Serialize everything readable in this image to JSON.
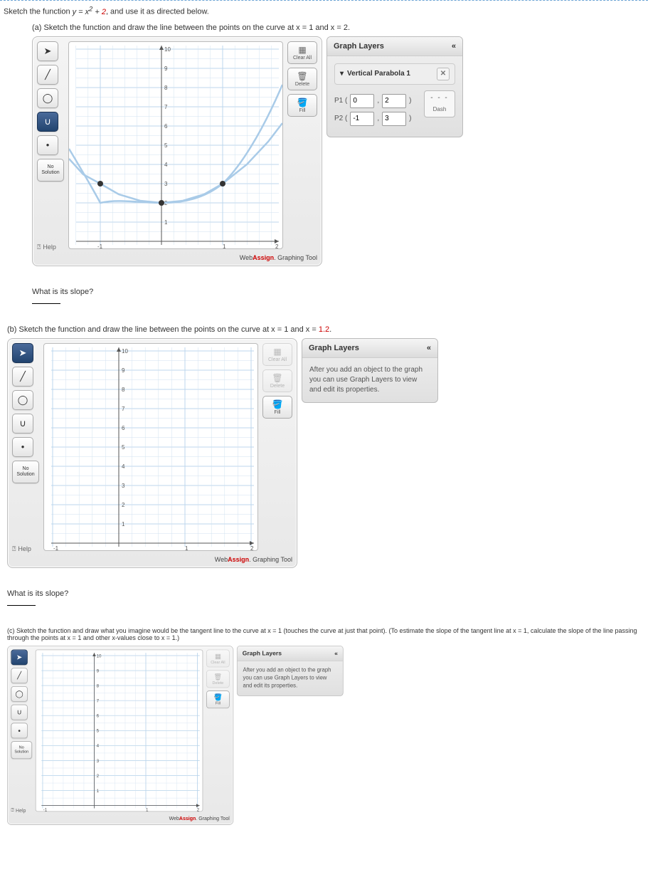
{
  "problem": {
    "intro_prefix": "Sketch the function ",
    "equation_y": "y = x",
    "equation_exp": "2",
    "equation_plus": " + ",
    "equation_const": "2",
    "intro_suffix": ", and use it as directed below.",
    "part_a": "(a) Sketch the function and draw the line between the points on the curve at x = 1 and x = 2.",
    "part_b_prefix": "(b) Sketch the function and draw the line between the points on the curve at x = 1 and x = ",
    "part_b_val": "1.2",
    "part_b_suffix": ".",
    "part_c": "(c) Sketch the function and draw what you imagine would be the tangent line to the curve at x = 1 (touches the curve at just that point). (To estimate the slope of the tangent line at x = 1, calculate the slope of the line passing through the points at x = 1 and other x-values close to x = 1.)",
    "slope_q": "What is its slope?"
  },
  "toolbar": {
    "nosol_line1": "No",
    "nosol_line2": "Solution",
    "help": "Help"
  },
  "right_tools": {
    "clearall": "Clear All",
    "delete": "Delete",
    "fill": "Fill"
  },
  "footer": {
    "brand1": "Web",
    "brand2": "Assign",
    "suffix": ". Graphing Tool"
  },
  "layers": {
    "title": "Graph Layers",
    "empty_msg": "After you add an object to the graph you can use Graph Layers to view and edit its properties.",
    "item1": "Vertical Parabola 1",
    "p1_label": "P1 (",
    "p2_label": "P2 (",
    "comma": ",",
    "close": ")",
    "p1_x": "0",
    "p1_y": "2",
    "p2_x": "-1",
    "p2_y": "3",
    "dash": "Dash"
  },
  "chart_data": {
    "type": "line",
    "title": "",
    "xlabel": "",
    "ylabel": "",
    "xlim": [
      -1,
      2
    ],
    "ylim": [
      0,
      10
    ],
    "xticks": [
      -1,
      1,
      2
    ],
    "yticks": [
      1,
      2,
      3,
      4,
      5,
      6,
      7,
      8,
      9,
      10
    ],
    "series": [
      {
        "name": "y = x^2 + 2",
        "type": "parabola",
        "x": [
          -1.5,
          -1,
          -0.5,
          0,
          0.5,
          1,
          1.5,
          2,
          2.5
        ],
        "y": [
          4.25,
          3,
          2.25,
          2,
          2.25,
          3,
          4.25,
          6,
          8.25
        ]
      }
    ],
    "control_points": [
      {
        "x": -1,
        "y": 3
      },
      {
        "x": 0,
        "y": 2
      },
      {
        "x": 1,
        "y": 3
      }
    ]
  }
}
